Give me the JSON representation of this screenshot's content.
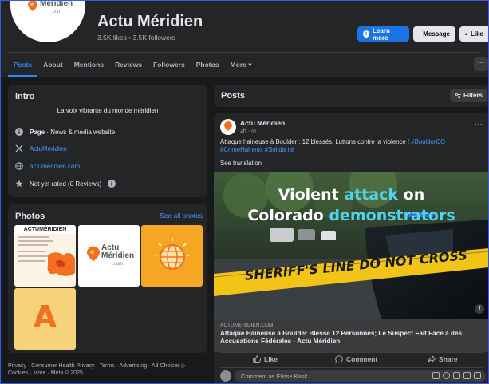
{
  "header": {
    "avatar_brand": "Méridien",
    "avatar_brand_sub": ".com",
    "page_name": "Actu Méridien",
    "stats": "3.5K likes • 3.5K followers",
    "learn_more": "Learn more",
    "message": "Message",
    "like": "Like"
  },
  "nav": {
    "tabs": [
      "Posts",
      "About",
      "Mentions",
      "Reviews",
      "Followers",
      "Photos",
      "More ▾"
    ],
    "more_dots": "···"
  },
  "intro": {
    "title": "Intro",
    "bio": "La voix vibrante du monde méridien",
    "page_label": "Page",
    "page_category": " · News & media website",
    "x_handle": "ActuMeridien",
    "website": "actumeridien.com",
    "rating": "Not yet rated (0 Reviews)"
  },
  "photos": {
    "title": "Photos",
    "see_all": "See all photos",
    "p1_title": "ACTUMÉRIDIEN",
    "p2_brand": "Actu",
    "p2_brand2": "Méridien",
    "p2_sub": ".com",
    "p4_letter": "A"
  },
  "footer": "Privacy · Consumer Health Privacy · Terms · Advertising · Ad Choices ▷ Cookies · More · Meta © 2025",
  "posts_header": {
    "title": "Posts",
    "filters": "Filters"
  },
  "post": {
    "author": "Actu Méridien",
    "time": "2h · ◎",
    "text": "Attaque haineuse à Boulder : 12 blessés. Luttons contre la violence ! ",
    "hashtags_line1": "#BoulderCO",
    "hashtags_line2": "#CrimeHaineux #Solidarité",
    "see_translation": "See translation",
    "image_headline_1a": "Violent ",
    "image_headline_1b": "attack",
    "image_headline_1c": " on",
    "image_headline_2a": "Colorado ",
    "image_headline_2b": "demonstrators",
    "tape_text": "SHERIFF'S LINE DO NOT CROSS",
    "tape_text_right": "SHERIFF'S L",
    "link_domain": "ACTUMERIDIEN.COM",
    "link_title": "Attaque Haineuse à Boulder Blesse 12 Personnes; Le Suspect Fait Face à des Accusations Fédérales - Actu Méridien",
    "like": "Like",
    "comment": "Comment",
    "share": "Share",
    "comment_placeholder": "Comment as Elisse Kask"
  },
  "colors": {
    "background": "#18191a",
    "card": "#242526",
    "accent_blue": "#1b74e4",
    "link_blue": "#4599ff",
    "headline_accent": "#4fd4f0",
    "tape_yellow": "#f2c418",
    "brand_orange": "#f5a623"
  }
}
